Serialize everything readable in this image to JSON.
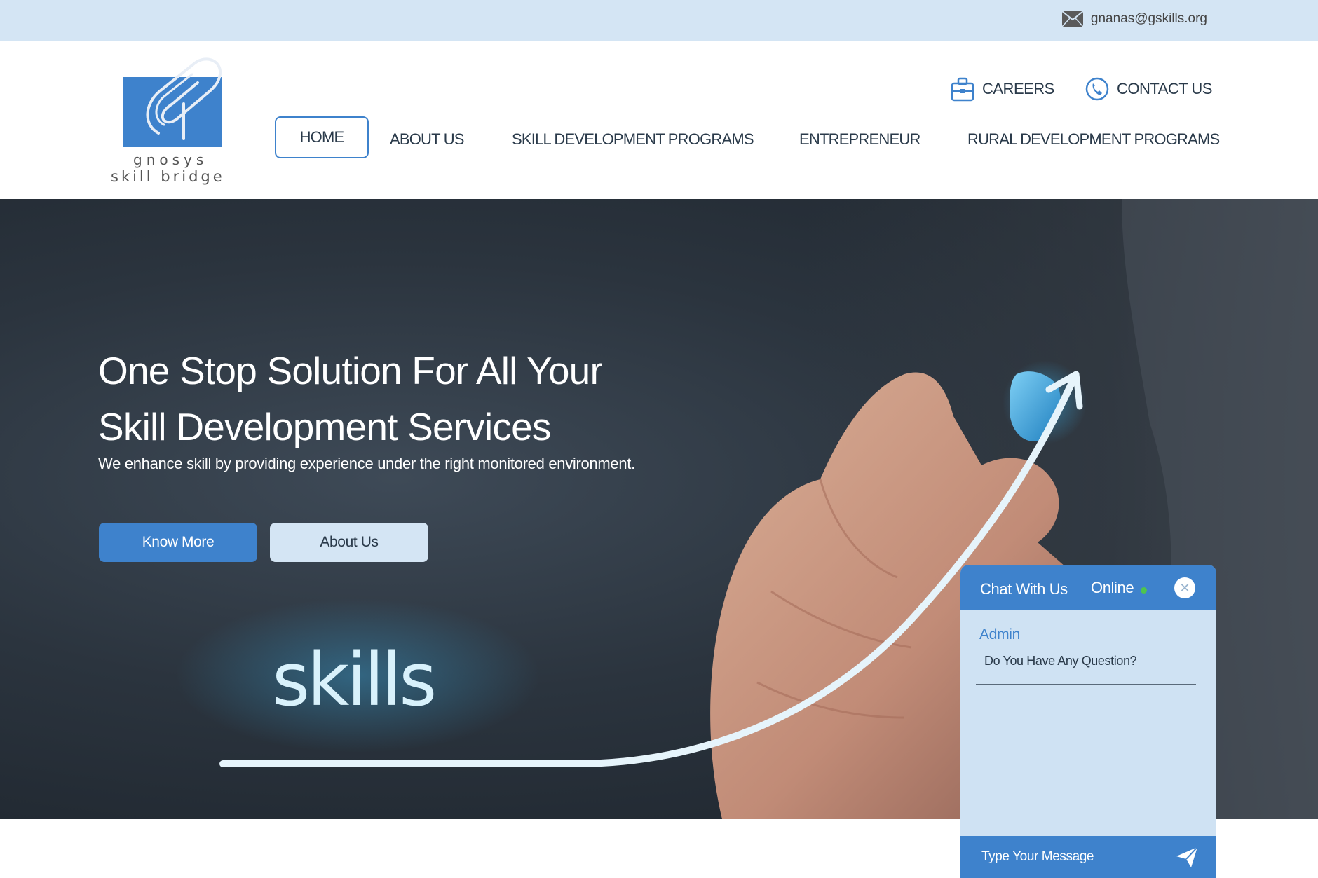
{
  "topbar": {
    "email": "gnanas@gskills.org",
    "email_icon": "mail-icon"
  },
  "logo": {
    "line1": "gnosys",
    "line2": "skill bridge"
  },
  "header": {
    "careers": "CAREERS",
    "contact": "CONTACT US",
    "nav": [
      "HOME",
      "ABOUT US",
      "SKILL DEVELOPMENT PROGRAMS",
      "ENTREPRENEUR",
      "RURAL DEVELOPMENT PROGRAMS"
    ],
    "active_nav": "HOME"
  },
  "hero": {
    "title": "One Stop Solution For All Your Skill Development Services",
    "subtitle": "We enhance skill by providing experience under the right monitored environment.",
    "primary_button": "Know More",
    "secondary_button": "About Us",
    "image_text": "skills"
  },
  "chat": {
    "title": "Chat With Us",
    "status": "Online",
    "sender": "Admin",
    "message": "Do You Have Any Question?",
    "input_placeholder": "Type Your Message"
  },
  "colors": {
    "accent": "#3e82cc",
    "light": "#d4e5f4",
    "online": "#4ec44e"
  }
}
